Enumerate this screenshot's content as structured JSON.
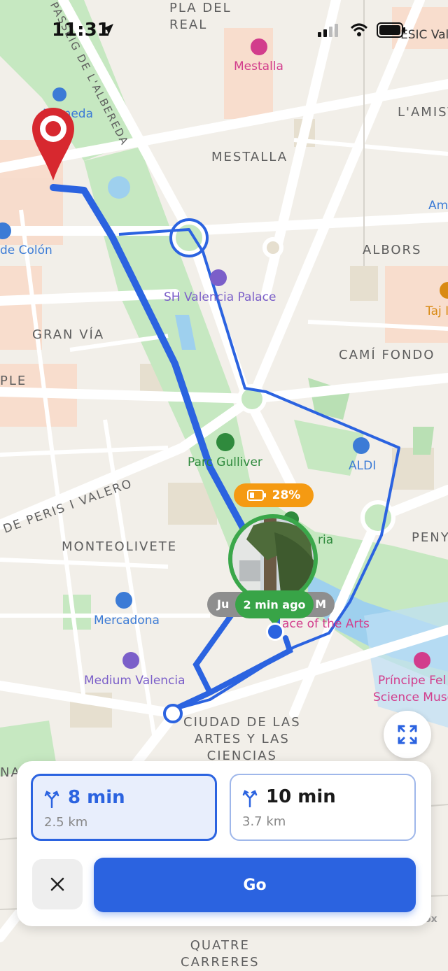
{
  "status_bar": {
    "time": "11:31"
  },
  "map": {
    "labels": {
      "pla_del_real": "PLA DEL\nREAL",
      "mestalla_poi": "Mestalla",
      "passeig": "PASSEIG DE L'ALBEREDA",
      "esic": "ESIC Val",
      "alameda": "Alameda",
      "lamis": "L'AMIST",
      "mestalla_area": "MESTALLA",
      "am": "Am",
      "colon": "de Colón",
      "albors": "ALBORS",
      "sh_valencia": "SH Valencia Palace",
      "taj": "Taj I",
      "gran_via": "GRAN VÍA",
      "cami_fondo": "CAMÍ FONDO",
      "ple": "PLE",
      "parc_gulliver": "Parc Gulliver",
      "aldi": "ALDI",
      "peris_valero": "DE PERIS I VALERO",
      "penya": "PENY",
      "monteolivete": "MONTEOLIVETE",
      "ria": "ria",
      "mercadona": "Mercadona",
      "palace_arts": "ace of the Arts",
      "medium_valencia": "Medium Valencia",
      "principe": "Príncipe Fel",
      "science": "Science Muse",
      "ciudad_artes": "CIUDAD DE LAS\nARTES Y LAS\nCIENCIAS",
      "na": "NA",
      "quatre": "QUATRE\nCARRERES",
      "attribution": "ox"
    },
    "battery_label": "28%",
    "grey_pill_left": "Ju",
    "grey_pill_right": "M",
    "last_seen": "2 min ago",
    "accent_color": "#2b63e0",
    "pin_color": "#d7282f"
  },
  "routes": [
    {
      "duration": "8 min",
      "distance": "2.5 km",
      "selected": true,
      "icon": "route-fork-icon"
    },
    {
      "duration": "10 min",
      "distance": "3.7 km",
      "selected": false,
      "icon": "route-fork-icon"
    }
  ],
  "actions": {
    "go_label": "Go",
    "close_icon": "close-icon",
    "expand_icon": "expand-icon"
  }
}
